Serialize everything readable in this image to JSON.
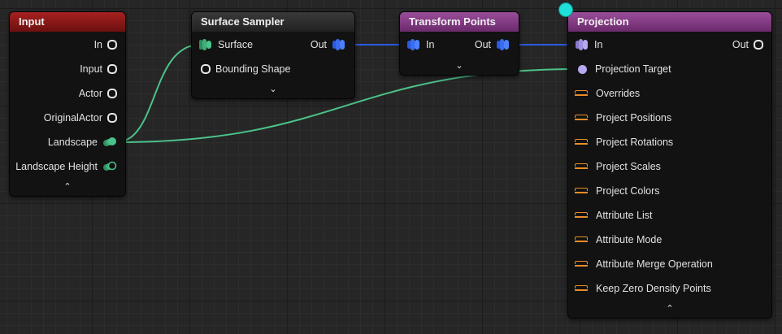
{
  "nodes": {
    "input": {
      "title": "Input",
      "pins": [
        "In",
        "Input",
        "Actor",
        "OriginalActor",
        "Landscape",
        "Landscape Height"
      ],
      "toggle": "⌃"
    },
    "surface_sampler": {
      "title": "Surface Sampler",
      "inputs": [
        "Surface",
        "Bounding Shape"
      ],
      "output": "Out",
      "toggle": "⌄"
    },
    "transform_points": {
      "title": "Transform Points",
      "input": "In",
      "output": "Out",
      "toggle": "⌄"
    },
    "projection": {
      "title": "Projection",
      "input": "In",
      "output": "Out",
      "target": "Projection Target",
      "params": [
        "Overrides",
        "Project Positions",
        "Project Rotations",
        "Project Scales",
        "Project Colors",
        "Attribute List",
        "Attribute Mode",
        "Attribute Merge Operation",
        "Keep Zero Density Points"
      ],
      "toggle": "⌃"
    }
  },
  "colors": {
    "input_header": "#9a1a1a",
    "sampler_header": "#2b2b2b",
    "transform_header": "#8a3a8a",
    "projection_header": "#8a3a8a",
    "spatial_wire": "#4cc28a",
    "point_wire": "#2a5ae0",
    "param_pin": "#e98d2a",
    "target_pin": "#b7a8f0"
  }
}
